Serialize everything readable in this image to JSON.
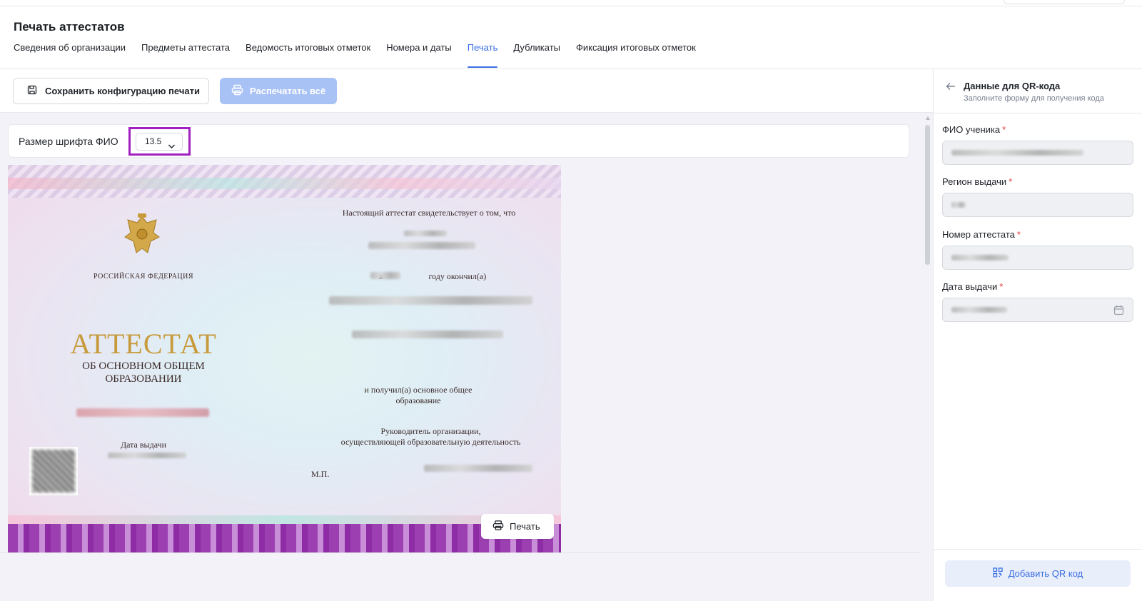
{
  "header": {
    "title": "Печать аттестатов",
    "tabs": [
      {
        "label": "Сведения об организации",
        "active": false
      },
      {
        "label": "Предметы аттестата",
        "active": false
      },
      {
        "label": "Ведомость итоговых отметок",
        "active": false
      },
      {
        "label": "Номера и даты",
        "active": false
      },
      {
        "label": "Печать",
        "active": true
      },
      {
        "label": "Дубликаты",
        "active": false
      },
      {
        "label": "Фиксация итоговых отметок",
        "active": false
      }
    ]
  },
  "toolbar": {
    "save_config_label": "Сохранить конфигурацию печати",
    "save_config_icon": "save-icon",
    "print_all_label": "Распечатать всё",
    "print_all_icon": "printer-icon",
    "print_all_disabled": true
  },
  "font_size": {
    "label": "Размер шрифта ФИО",
    "value": "13.5"
  },
  "certificate": {
    "country": "РОССИЙСКАЯ ФЕДЕРАЦИЯ",
    "title": "АТТЕСТАТ",
    "subtitle_line1": "ОБ ОСНОВНОМ ОБЩЕМ",
    "subtitle_line2": "ОБРАЗОВАНИИ",
    "date_label": "Дата выдачи",
    "intro": "Настоящий аттестат свидетельствует о том, что",
    "year_prefix": "в",
    "year_suffix": "году окончил(а)",
    "received_line1": "и получил(а) основное общее",
    "received_line2": "образование",
    "head_line1": "Руководитель организации,",
    "head_line2": "осуществляющей образовательную деятельность",
    "stamp": "М.П.",
    "print_button": "Печать"
  },
  "qr_panel": {
    "title": "Данные для QR-кода",
    "subtitle": "Заполните форму для получения кода",
    "fields": [
      {
        "label": "ФИО ученика",
        "required_mark": "*"
      },
      {
        "label": "Регион выдачи",
        "required_mark": "*"
      },
      {
        "label": "Номер аттестата",
        "required_mark": "*"
      },
      {
        "label": "Дата выдачи",
        "required_mark": "*"
      }
    ],
    "add_button": "Добавить QR код"
  },
  "colors": {
    "accent": "#3b6fe3",
    "highlight": "#a21fc1",
    "required": "#e23c3c"
  }
}
